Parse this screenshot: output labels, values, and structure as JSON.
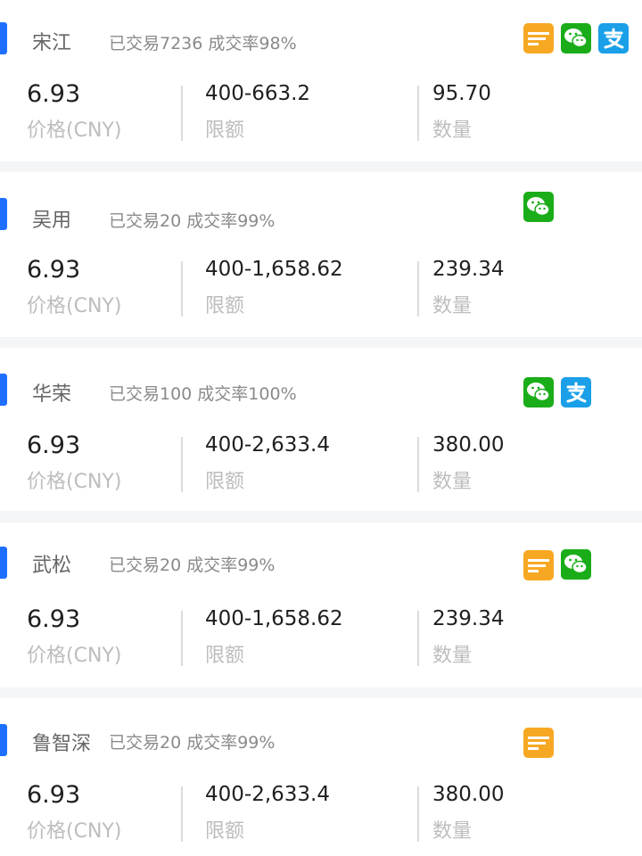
{
  "labels": {
    "price": "价格(CNY)",
    "limit": "限额",
    "quantity": "数量"
  },
  "colors": {
    "accent": "#1e6fff",
    "bank": "#f7a823",
    "wechat": "#1aad19",
    "alipay": "#1a9fe8"
  },
  "merchants": [
    {
      "name": "宋江",
      "stats": "已交易7236 成交率98%",
      "price": "6.93",
      "limit": "400-663.2",
      "quantity": "95.70",
      "payments": [
        "bank-card-icon",
        "wechat-pay-icon",
        "alipay-icon"
      ]
    },
    {
      "name": "吴用",
      "stats": "已交易20 成交率99%",
      "price": "6.93",
      "limit": "400-1,658.62",
      "quantity": "239.34",
      "payments": [
        "wechat-pay-icon"
      ]
    },
    {
      "name": "华荣",
      "stats": "已交易100 成交率100%",
      "price": "6.93",
      "limit": "400-2,633.4",
      "quantity": "380.00",
      "payments": [
        "wechat-pay-icon",
        "alipay-icon"
      ]
    },
    {
      "name": "武松",
      "stats": "已交易20 成交率99%",
      "price": "6.93",
      "limit": "400-1,658.62",
      "quantity": "239.34",
      "payments": [
        "bank-card-icon",
        "wechat-pay-icon"
      ]
    },
    {
      "name": "鲁智深",
      "stats": "已交易20 成交率99%",
      "price": "6.93",
      "limit": "400-2,633.4",
      "quantity": "380.00",
      "payments": [
        "bank-card-icon"
      ]
    }
  ]
}
